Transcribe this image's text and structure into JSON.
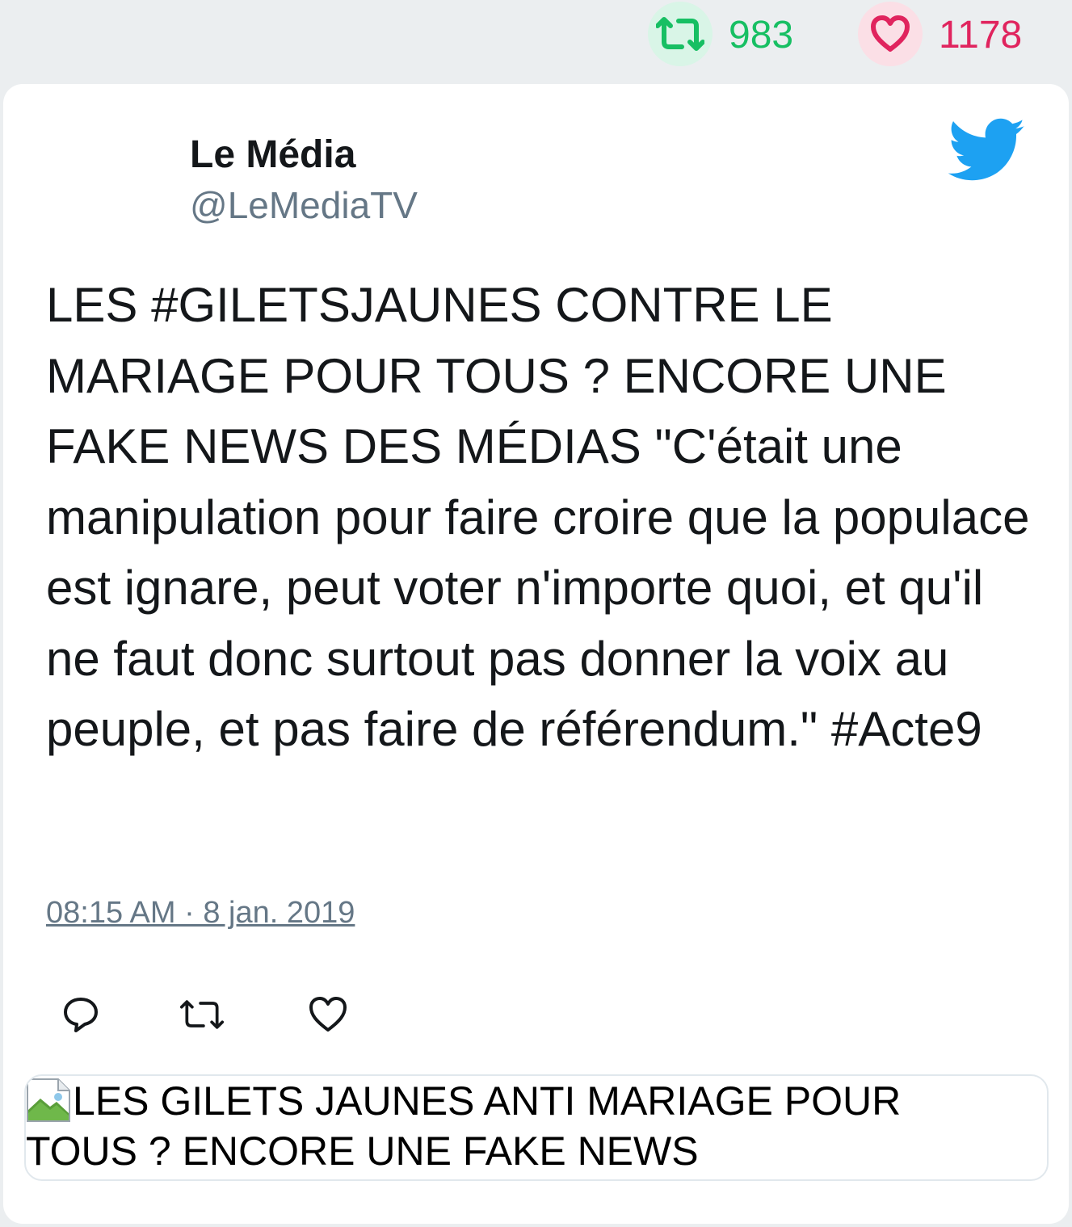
{
  "stats": {
    "retweets": "983",
    "likes": "1178",
    "retweet_icon": "retweet-icon",
    "like_icon": "heart-icon",
    "retweet_color": "#17bf63",
    "like_color": "#e0245e"
  },
  "tweet": {
    "author_name": "Le Média",
    "author_handle": "@LeMediaTV",
    "text": "LES #GILETSJAUNES CONTRE LE MARIAGE POUR TOUS ? ENCORE UNE FAKE NEWS DES MÉDIAS \"C'était une manipulation pour faire croire que la populace est ignare, peut voter n'importe quoi, et qu'il ne faut donc surtout pas donner la voix au peuple, et pas faire de référendum.\" #Acte9",
    "timestamp": "08:15 AM · 8 jan. 2019",
    "brand_icon": "twitter-bird-icon",
    "brand_color": "#1da1f2"
  },
  "actions": {
    "reply_icon": "reply-icon",
    "retweet_icon": "retweet-icon",
    "like_icon": "heart-icon"
  },
  "link_card": {
    "title": "LES GILETS JAUNES ANTI MARIAGE POUR TOUS ? ENCORE UNE FAKE NEWS",
    "image_icon": "broken-image-icon"
  }
}
